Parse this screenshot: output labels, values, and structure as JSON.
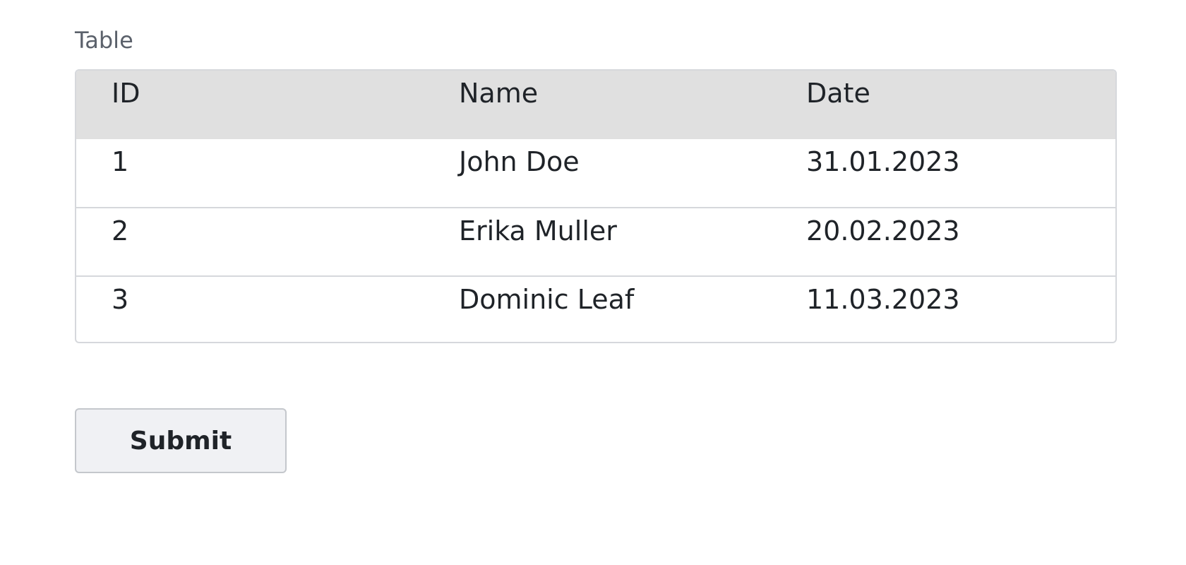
{
  "table": {
    "label": "Table",
    "columns": [
      "ID",
      "Name",
      "Date"
    ],
    "rows": [
      [
        "1",
        "John Doe",
        "31.01.2023"
      ],
      [
        "2",
        "Erika Muller",
        "20.02.2023"
      ],
      [
        "3",
        "Dominic Leaf",
        "11.03.2023"
      ]
    ]
  },
  "form": {
    "submit_label": "Submit"
  }
}
